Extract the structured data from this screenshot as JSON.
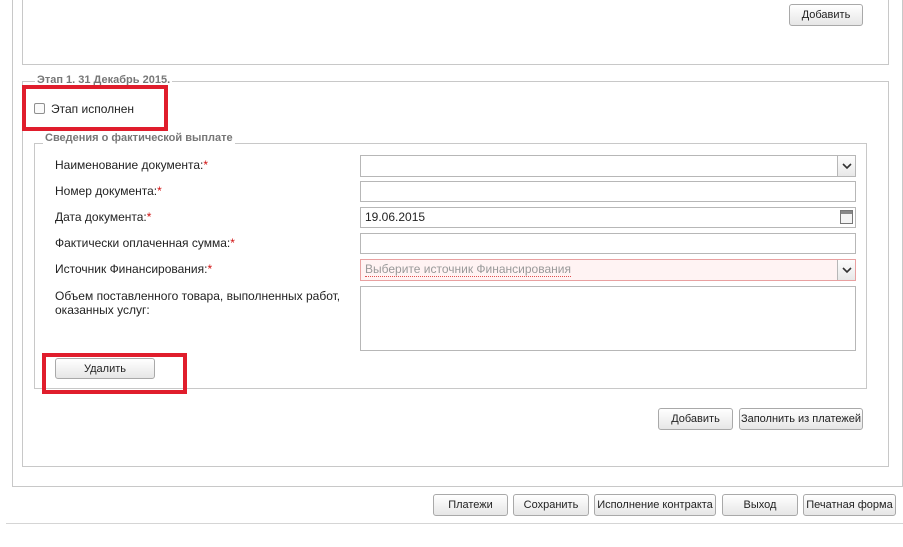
{
  "top_add_button": "Добавить",
  "stage": {
    "legend": "Этап 1. 31 Декабрь 2015.",
    "completed_checkbox_label": "Этап исполнен",
    "completed": false
  },
  "payment_section": {
    "legend": "Сведения о фактической выплате",
    "fields": {
      "doc_name_label": "Наименование документа:",
      "doc_number_label": "Номер документа:",
      "doc_date_label": "Дата документа:",
      "doc_date_value": "19.06.2015",
      "paid_amount_label": "Фактически оплаченная сумма:",
      "funding_source_label": "Источник Финансирования:",
      "funding_source_placeholder": "Выберите источник Финансирования",
      "volume_label": "Объем поставленного товара, выполненных работ, оказанных услуг:",
      "required_mark": "*"
    },
    "delete_button": "Удалить"
  },
  "stage_buttons": {
    "add": "Добавить",
    "fill_from_payments": "Заполнить из платежей"
  },
  "footer_buttons": {
    "payments": "Платежи",
    "save": "Сохранить",
    "contract_execution": "Исполнение контракта",
    "exit": "Выход",
    "print_form": "Печатная форма"
  },
  "colors": {
    "highlight": "#e01d2c",
    "required": "#d01010",
    "panel_border": "#c8c8c8"
  }
}
